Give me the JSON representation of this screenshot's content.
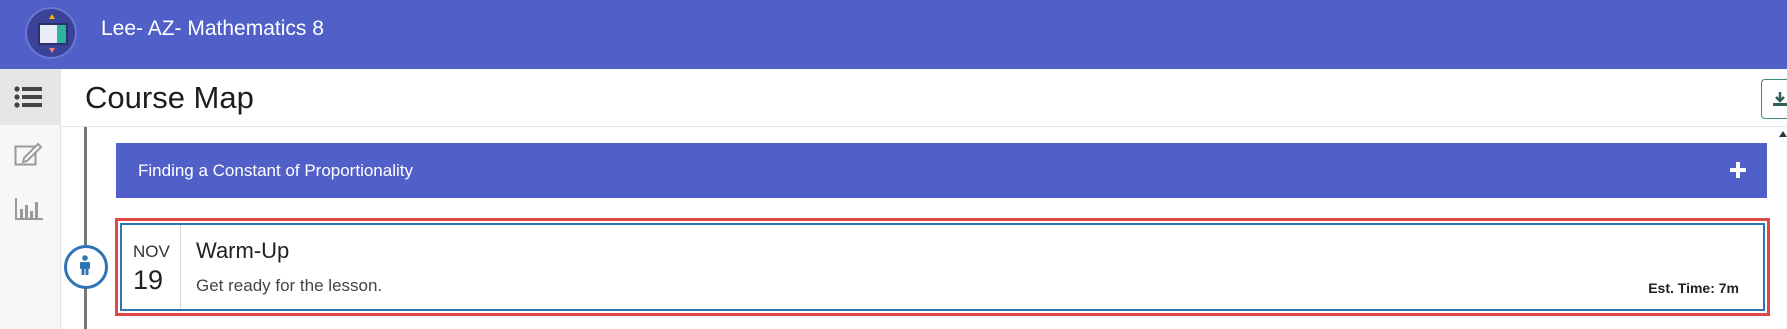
{
  "header": {
    "app_title": "Lee- AZ- Mathematics 8",
    "logo_icon": "course-app-logo-icon",
    "background_color": "#515fc8"
  },
  "sidebar": {
    "items": [
      {
        "icon": "list-icon",
        "active": true
      },
      {
        "icon": "edit-icon",
        "active": false
      },
      {
        "icon": "bar-chart-icon",
        "active": false
      }
    ]
  },
  "page": {
    "title": "Course Map",
    "download_icon": "download-icon"
  },
  "section": {
    "title": "Finding a Constant of Proportionality",
    "expand_icon": "plus-icon",
    "color": "#515fc8"
  },
  "activity": {
    "month": "NOV",
    "day": "19",
    "title": "Warm-Up",
    "description": "Get ready for the lesson.",
    "est_time": "Est. Time: 7m",
    "node_icon": "person-icon",
    "highlight_color": "#e04848",
    "border_color": "#2f74b5"
  }
}
